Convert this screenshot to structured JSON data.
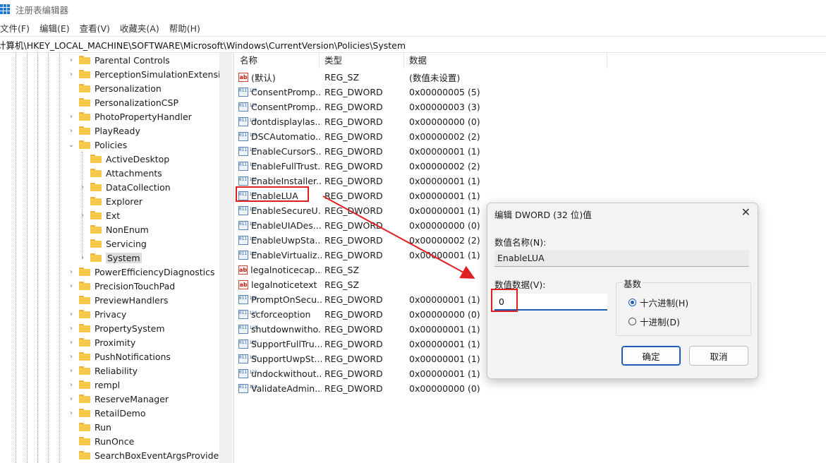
{
  "app": {
    "title": "注册表编辑器"
  },
  "menu": [
    "文件(F)",
    "编辑(E)",
    "查看(V)",
    "收藏夹(A)",
    "帮助(H)"
  ],
  "address": "计算机\\HKEY_LOCAL_MACHINE\\SOFTWARE\\Microsoft\\Windows\\CurrentVersion\\Policies\\System",
  "tree": [
    {
      "label": "Parental Controls",
      "expand": true
    },
    {
      "label": "PerceptionSimulationExtensions",
      "expand": true
    },
    {
      "label": "Personalization",
      "expand": false
    },
    {
      "label": "PersonalizationCSP",
      "expand": false
    },
    {
      "label": "PhotoPropertyHandler",
      "expand": true
    },
    {
      "label": "PlayReady",
      "expand": true
    },
    {
      "label": "Policies",
      "expand": "open"
    },
    {
      "label": "ActiveDesktop",
      "expand": false,
      "child": true
    },
    {
      "label": "Attachments",
      "expand": false,
      "child": true
    },
    {
      "label": "DataCollection",
      "expand": true,
      "child": true
    },
    {
      "label": "Explorer",
      "expand": false,
      "child": true
    },
    {
      "label": "Ext",
      "expand": true,
      "child": true
    },
    {
      "label": "NonEnum",
      "expand": false,
      "child": true
    },
    {
      "label": "Servicing",
      "expand": false,
      "child": true
    },
    {
      "label": "System",
      "expand": true,
      "child": true,
      "selected": true
    },
    {
      "label": "PowerEfficiencyDiagnostics",
      "expand": true
    },
    {
      "label": "PrecisionTouchPad",
      "expand": true
    },
    {
      "label": "PreviewHandlers",
      "expand": false
    },
    {
      "label": "Privacy",
      "expand": true
    },
    {
      "label": "PropertySystem",
      "expand": true
    },
    {
      "label": "Proximity",
      "expand": true
    },
    {
      "label": "PushNotifications",
      "expand": true
    },
    {
      "label": "Reliability",
      "expand": true
    },
    {
      "label": "rempl",
      "expand": true
    },
    {
      "label": "ReserveManager",
      "expand": true
    },
    {
      "label": "RetailDemo",
      "expand": true
    },
    {
      "label": "Run",
      "expand": false
    },
    {
      "label": "RunOnce",
      "expand": false
    },
    {
      "label": "SearchBoxEventArgsProvider",
      "expand": false
    }
  ],
  "columns": {
    "name": "名称",
    "type": "类型",
    "data": "数据"
  },
  "values": [
    {
      "icon": "ab",
      "name": "(默认)",
      "type": "REG_SZ",
      "data": "(数值未设置)"
    },
    {
      "icon": "dw",
      "name": "ConsentPromp...",
      "type": "REG_DWORD",
      "data": "0x00000005 (5)"
    },
    {
      "icon": "dw",
      "name": "ConsentPromp...",
      "type": "REG_DWORD",
      "data": "0x00000003 (3)"
    },
    {
      "icon": "dw",
      "name": "dontdisplaylas...",
      "type": "REG_DWORD",
      "data": "0x00000000 (0)"
    },
    {
      "icon": "dw",
      "name": "DSCAutomatio...",
      "type": "REG_DWORD",
      "data": "0x00000002 (2)"
    },
    {
      "icon": "dw",
      "name": "EnableCursorS...",
      "type": "REG_DWORD",
      "data": "0x00000001 (1)"
    },
    {
      "icon": "dw",
      "name": "EnableFullTrust...",
      "type": "REG_DWORD",
      "data": "0x00000002 (2)"
    },
    {
      "icon": "dw",
      "name": "EnableInstaller...",
      "type": "REG_DWORD",
      "data": "0x00000001 (1)"
    },
    {
      "icon": "dw",
      "name": "EnableLUA",
      "type": "REG_DWORD",
      "data": "0x00000001 (1)"
    },
    {
      "icon": "dw",
      "name": "EnableSecureU...",
      "type": "REG_DWORD",
      "data": "0x00000001 (1)"
    },
    {
      "icon": "dw",
      "name": "EnableUIADes...",
      "type": "REG_DWORD",
      "data": "0x00000000 (0)"
    },
    {
      "icon": "dw",
      "name": "EnableUwpSta...",
      "type": "REG_DWORD",
      "data": "0x00000002 (2)"
    },
    {
      "icon": "dw",
      "name": "EnableVirtualiz...",
      "type": "REG_DWORD",
      "data": "0x00000001 (1)"
    },
    {
      "icon": "ab",
      "name": "legalnoticecap...",
      "type": "REG_SZ",
      "data": ""
    },
    {
      "icon": "ab",
      "name": "legalnoticetext",
      "type": "REG_SZ",
      "data": ""
    },
    {
      "icon": "dw",
      "name": "PromptOnSecu...",
      "type": "REG_DWORD",
      "data": "0x00000001 (1)"
    },
    {
      "icon": "dw",
      "name": "scforceoption",
      "type": "REG_DWORD",
      "data": "0x00000000 (0)"
    },
    {
      "icon": "dw",
      "name": "shutdownwitho...",
      "type": "REG_DWORD",
      "data": "0x00000001 (1)"
    },
    {
      "icon": "dw",
      "name": "SupportFullTru...",
      "type": "REG_DWORD",
      "data": "0x00000001 (1)"
    },
    {
      "icon": "dw",
      "name": "SupportUwpSt...",
      "type": "REG_DWORD",
      "data": "0x00000001 (1)"
    },
    {
      "icon": "dw",
      "name": "undockwithout...",
      "type": "REG_DWORD",
      "data": "0x00000001 (1)"
    },
    {
      "icon": "dw",
      "name": "ValidateAdmin...",
      "type": "REG_DWORD",
      "data": "0x00000000 (0)"
    }
  ],
  "dialog": {
    "title": "编辑 DWORD (32 位)值",
    "name_label": "数值名称(N):",
    "name_value": "EnableLUA",
    "data_label": "数值数据(V):",
    "data_value": "0",
    "base_label": "基数",
    "hex_label": "十六进制(H)",
    "dec_label": "十进制(D)",
    "selected_base": "hex",
    "ok": "确定",
    "cancel": "取消"
  },
  "colors": {
    "highlight": "#e02020",
    "accent": "#1f5bb6",
    "folder": "#f6c94a"
  }
}
